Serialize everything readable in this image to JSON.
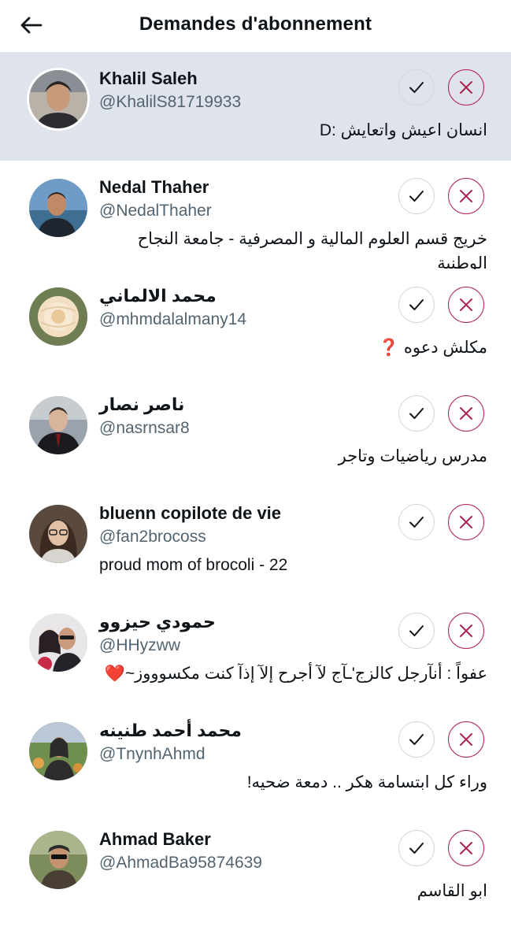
{
  "header": {
    "title": "Demandes d'abonnement",
    "back_icon": "arrow-left-icon"
  },
  "colors": {
    "highlight_row": "#dfe3ec",
    "decline_accent": "#b0224f",
    "muted_text": "#536471"
  },
  "requests": [
    {
      "name": "Khalil Saleh",
      "handle": "@KhalilS81719933",
      "bio": "انسان اعيش واتعايش :D",
      "bio_rtl": true,
      "highlighted": true
    },
    {
      "name": "Nedal Thaher",
      "handle": "@NedalThaher",
      "bio": "خريج قسم العلوم المالية و المصرفية - جامعة النجاح الوطنية",
      "bio_rtl": true,
      "highlighted": false
    },
    {
      "name": "محمد الالماني",
      "handle": "@mhmdalalmany14",
      "bio": "مكلش دعوه ❓",
      "bio_rtl": true,
      "highlighted": false
    },
    {
      "name": "ناصر نصار",
      "handle": "@nasrnsar8",
      "bio": "مدرس رياضيات وتاجر",
      "bio_rtl": true,
      "highlighted": false
    },
    {
      "name": "bluenn copilote de vie",
      "handle": "@fan2brocoss",
      "bio": "proud mom of brocoli - 22",
      "bio_rtl": false,
      "highlighted": false
    },
    {
      "name": "حمودي حيزوو",
      "handle": "@HHyzww",
      "bio": "عفواً : أنآرجل كالزج'ـآج لآ أجرح إلآ إذآ كنت مكسوووز~❤️",
      "bio_rtl": true,
      "highlighted": false
    },
    {
      "name": "محمد أحمد طنينه",
      "handle": "@TnynhAhmd",
      "bio": "وراء كل ابتسامة هكر .. دمعة ضحيه!",
      "bio_rtl": true,
      "highlighted": false
    },
    {
      "name": "Ahmad Baker",
      "handle": "@AhmadBa95874639",
      "bio": "ابو القاسم",
      "bio_rtl": true,
      "highlighted": false
    }
  ],
  "actions": {
    "accept_icon": "checkmark-icon",
    "decline_icon": "close-icon"
  }
}
